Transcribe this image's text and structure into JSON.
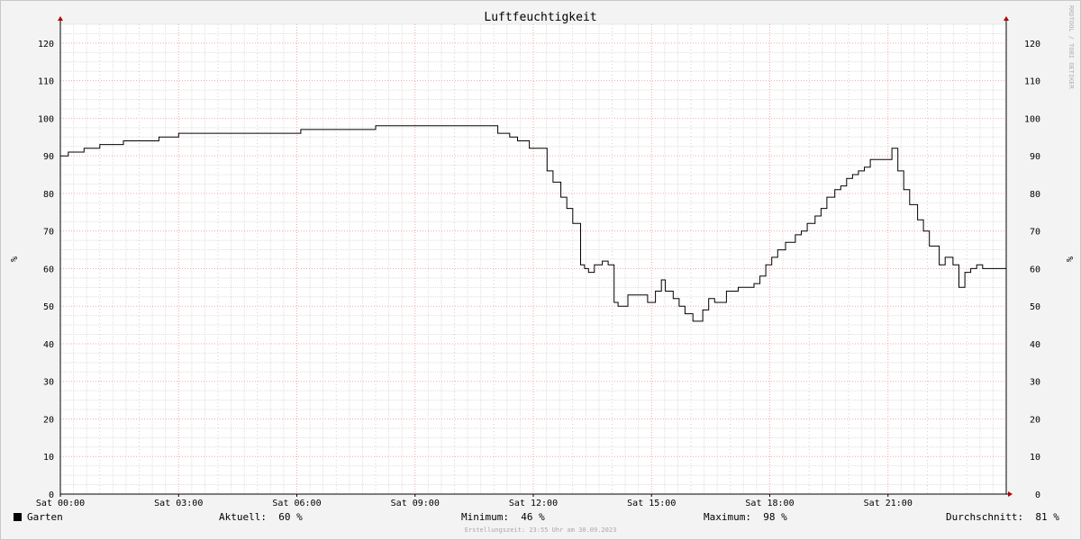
{
  "chart_data": {
    "type": "line",
    "title": "Luftfeuchtigkeit",
    "ylabel": "%",
    "ylabel_right": "%",
    "side_label": "RRDTOOL / TOBI OETIKER",
    "ylim": [
      0,
      125
    ],
    "xlim_hours": [
      0,
      24
    ],
    "y_ticks": [
      0,
      10,
      20,
      30,
      40,
      50,
      60,
      70,
      80,
      90,
      100,
      110,
      120
    ],
    "x_ticks": [
      {
        "hour": 0,
        "label": "Sat 00:00"
      },
      {
        "hour": 3,
        "label": "Sat 03:00"
      },
      {
        "hour": 6,
        "label": "Sat 06:00"
      },
      {
        "hour": 9,
        "label": "Sat 09:00"
      },
      {
        "hour": 12,
        "label": "Sat 12:00"
      },
      {
        "hour": 15,
        "label": "Sat 15:00"
      },
      {
        "hour": 18,
        "label": "Sat 18:00"
      },
      {
        "hour": 21,
        "label": "Sat 21:00"
      }
    ],
    "grid": true,
    "line_color": "#000000",
    "series": [
      {
        "name": "Garten",
        "color": "#000000",
        "points": [
          [
            0.0,
            90
          ],
          [
            0.2,
            91
          ],
          [
            0.6,
            92
          ],
          [
            1.0,
            93
          ],
          [
            1.6,
            94
          ],
          [
            2.5,
            95
          ],
          [
            3.0,
            96
          ],
          [
            6.1,
            97
          ],
          [
            8.0,
            98
          ],
          [
            11.1,
            96
          ],
          [
            11.4,
            95
          ],
          [
            11.6,
            94
          ],
          [
            11.9,
            92
          ],
          [
            12.35,
            86
          ],
          [
            12.5,
            83
          ],
          [
            12.7,
            79
          ],
          [
            12.85,
            76
          ],
          [
            13.0,
            72
          ],
          [
            13.2,
            61
          ],
          [
            13.3,
            60
          ],
          [
            13.4,
            59
          ],
          [
            13.55,
            61
          ],
          [
            13.75,
            62
          ],
          [
            13.9,
            61
          ],
          [
            14.05,
            51
          ],
          [
            14.15,
            50
          ],
          [
            14.4,
            53
          ],
          [
            14.9,
            51
          ],
          [
            15.1,
            54
          ],
          [
            15.25,
            57
          ],
          [
            15.35,
            54
          ],
          [
            15.55,
            52
          ],
          [
            15.7,
            50
          ],
          [
            15.85,
            48
          ],
          [
            16.05,
            46
          ],
          [
            16.3,
            49
          ],
          [
            16.45,
            52
          ],
          [
            16.6,
            51
          ],
          [
            16.9,
            54
          ],
          [
            17.2,
            55
          ],
          [
            17.6,
            56
          ],
          [
            17.75,
            58
          ],
          [
            17.9,
            61
          ],
          [
            18.05,
            63
          ],
          [
            18.2,
            65
          ],
          [
            18.4,
            67
          ],
          [
            18.65,
            69
          ],
          [
            18.8,
            70
          ],
          [
            18.95,
            72
          ],
          [
            19.15,
            74
          ],
          [
            19.3,
            76
          ],
          [
            19.45,
            79
          ],
          [
            19.65,
            81
          ],
          [
            19.8,
            82
          ],
          [
            19.95,
            84
          ],
          [
            20.1,
            85
          ],
          [
            20.25,
            86
          ],
          [
            20.4,
            87
          ],
          [
            20.55,
            89
          ],
          [
            21.1,
            92
          ],
          [
            21.25,
            86
          ],
          [
            21.4,
            81
          ],
          [
            21.55,
            77
          ],
          [
            21.75,
            73
          ],
          [
            21.9,
            70
          ],
          [
            22.05,
            66
          ],
          [
            22.3,
            61
          ],
          [
            22.45,
            63
          ],
          [
            22.65,
            61
          ],
          [
            22.8,
            55
          ],
          [
            22.95,
            59
          ],
          [
            23.1,
            60
          ],
          [
            23.25,
            61
          ],
          [
            23.4,
            60
          ]
        ]
      }
    ]
  },
  "legend": {
    "series_label": "Garten",
    "current_label": "Aktuell:",
    "current_value": "60 %",
    "min_label": "Minimum:",
    "min_value": "46 %",
    "max_label": "Maximum:",
    "max_value": "98 %",
    "avg_label": "Durchschnitt:",
    "avg_value": "81 %"
  },
  "footer": "Erstellungszeit: 23:55 Uhr am 30.09.2023"
}
